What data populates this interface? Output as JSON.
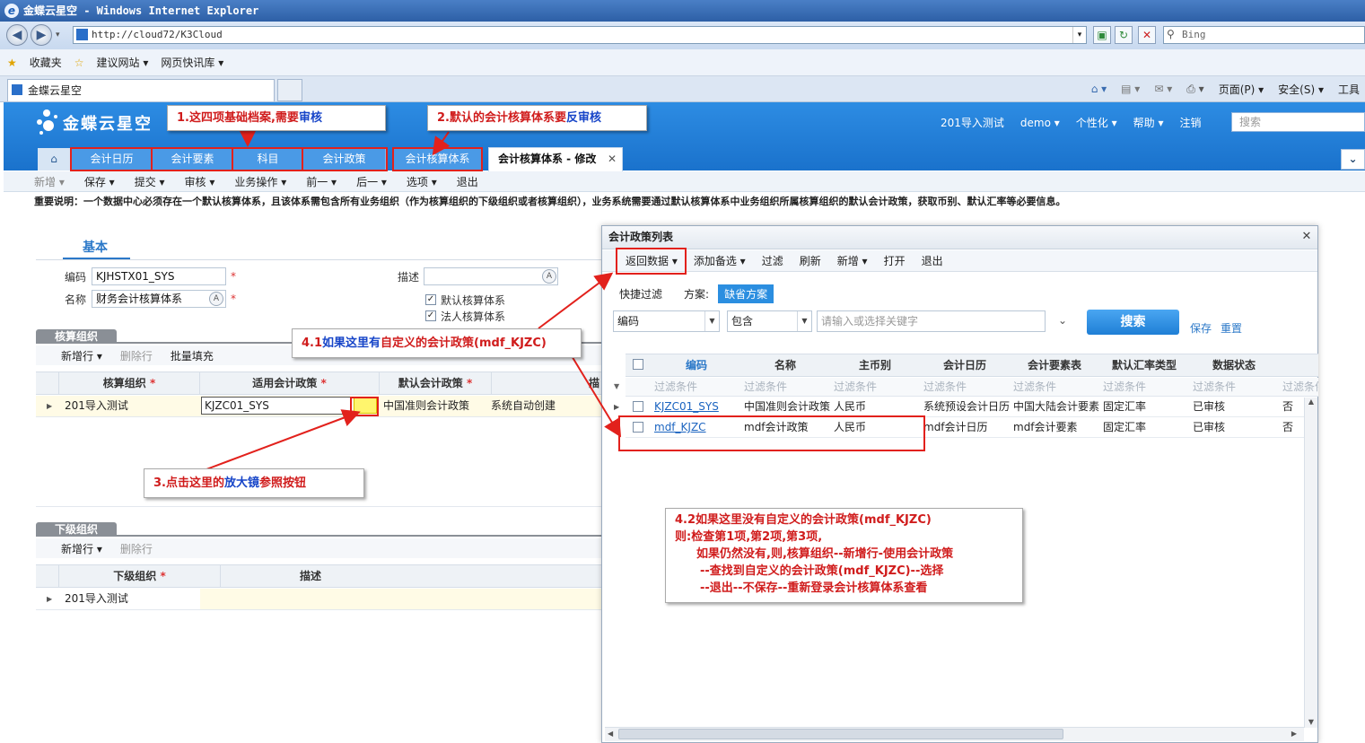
{
  "ie": {
    "window_title": "金蝶云星空 - Windows Internet Explorer",
    "address": "http://cloud72/K3Cloud",
    "search_placeholder": "Bing",
    "favorites": [
      "收藏夹",
      "建议网站 ▾",
      "网页快讯库 ▾"
    ],
    "tab_title": "金蝶云星空",
    "commands": [
      "页面(P) ▾",
      "安全(S) ▾",
      "工具"
    ]
  },
  "app": {
    "logo": "金蝶云星空",
    "user_menu": [
      "201导入测试",
      "demo ▾",
      "个性化 ▾",
      "帮助 ▾",
      "注销"
    ],
    "search_placeholder": "搜索",
    "tabs": [
      "会计日历",
      "会计要素",
      "科目",
      "会计政策",
      "会计核算体系"
    ],
    "active_tab": "会计核算体系 - 修改",
    "toolbar": [
      "新增 ▾",
      "保存 ▾",
      "提交 ▾",
      "审核 ▾",
      "业务操作 ▾",
      "前一 ▾",
      "后一 ▾",
      "选项 ▾",
      "退出"
    ],
    "notice": "重要说明：一个数据中心必须存在一个默认核算体系，且该体系需包含所有业务组织（作为核算组织的下级组织或者核算组织），业务系统需要通过默认核算体系中业务组织所属核算组织的默认会计政策，获取币别、默认汇率等必要信息。"
  },
  "form": {
    "basic_tab": "基本",
    "code_label": "编码",
    "code_value": "KJHSTX01_SYS",
    "name_label": "名称",
    "name_value": "财务会计核算体系",
    "desc_label": "描述",
    "default_system": "默认核算体系",
    "legal_system": "法人核算体系"
  },
  "accounting_org": {
    "section": "核算组织",
    "toolbar": [
      "新增行 ▾",
      "删除行",
      "批量填充"
    ],
    "headers": [
      "核算组织",
      "适用会计政策",
      "默认会计政策",
      "描"
    ],
    "row": {
      "org": "201导入测试",
      "policy": "KJZC01_SYS",
      "default_policy": "中国准则会计政策",
      "desc": "系统自动创建"
    }
  },
  "sub_org": {
    "section": "下级组织",
    "toolbar": [
      "新增行 ▾",
      "删除行"
    ],
    "headers": [
      "下级组织",
      "描述"
    ],
    "row": {
      "org": "201导入测试"
    }
  },
  "dialog": {
    "title": "会计政策列表",
    "toolbar": [
      "返回数据 ▾",
      "添加备选 ▾",
      "过滤",
      "刷新",
      "新增 ▾",
      "打开",
      "退出"
    ],
    "quick_filter": "快捷过滤",
    "scheme_label": "方案:",
    "scheme_value": "缺省方案",
    "field": "编码",
    "operator": "包含",
    "keyword_placeholder": "请输入或选择关键字",
    "search_btn": "搜索",
    "save": "保存",
    "reset": "重置",
    "headers": [
      "编码",
      "名称",
      "主币别",
      "会计日历",
      "会计要素表",
      "默认汇率类型",
      "数据状态"
    ],
    "filter_placeholder": "过滤条件",
    "rows": [
      {
        "code": "KJZC01_SYS",
        "name": "中国准则会计政策",
        "currency": "人民币",
        "calendar": "系统预设会计日历",
        "elements": "中国大陆会计要素",
        "rate": "固定汇率",
        "status": "已审核",
        "flag": "否"
      },
      {
        "code": "mdf_KJZC",
        "name": "mdf会计政策",
        "currency": "人民币",
        "calendar": "mdf会计日历",
        "elements": "mdf会计要素",
        "rate": "固定汇率",
        "status": "已审核",
        "flag": "否"
      }
    ]
  },
  "callouts": {
    "c1_a": "1.这四项基础档案,需要",
    "c1_b": "审核",
    "c2_a": "2.默认的会计核算体系要",
    "c2_b": "反审核",
    "c3_a": "3.点击这里的",
    "c3_b": "放大镜",
    "c3_c": "参照按钮",
    "c41_a": "4.1",
    "c41_b": "如果这里有",
    "c41_c": "自定义的会计政策(mdf_KJZC)",
    "c42_lines": [
      "4.2如果这里没有自定义的会计政策(mdf_KJZC)",
      "则:检查第1项,第2项,第3项,",
      "如果仍然没有,则,核算组织--新增行-使用会计政策",
      "--查找到自定义的会计政策(mdf_KJZC)--选择",
      "--退出--不保存--重新登录会计核算体系查看"
    ]
  }
}
